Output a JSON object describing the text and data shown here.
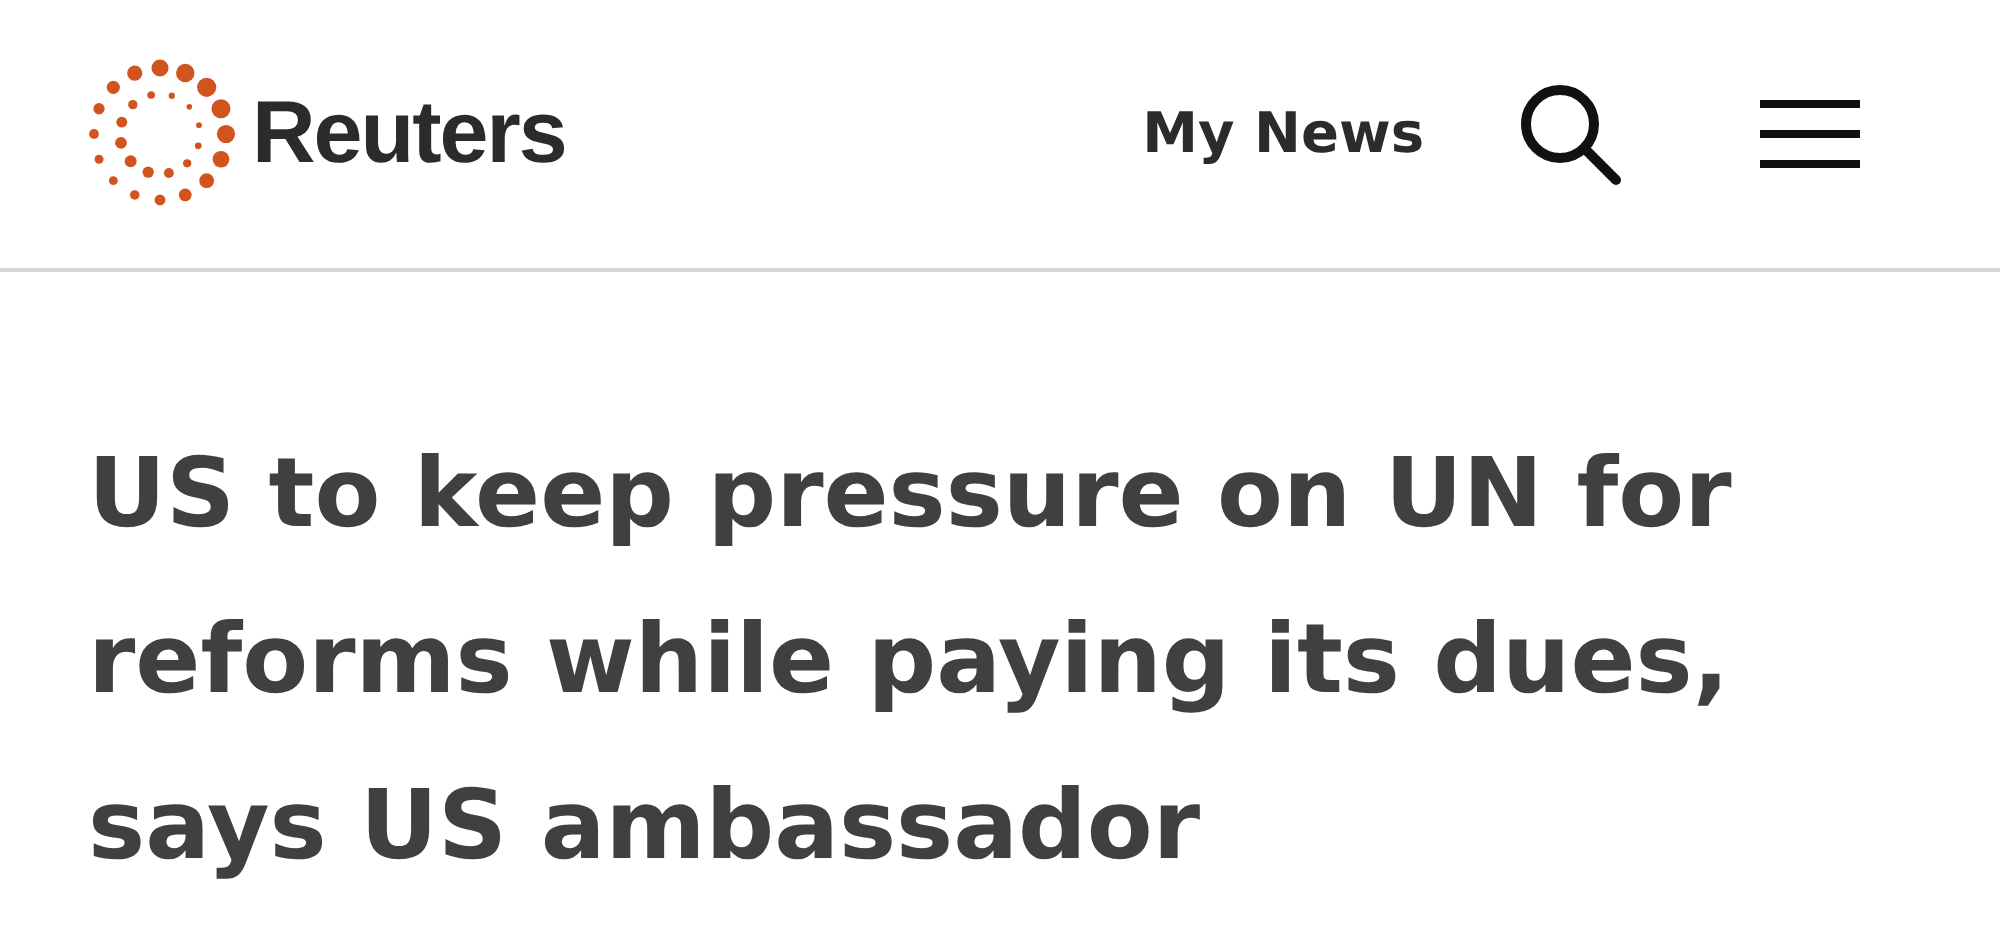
{
  "header": {
    "brand": "Reuters",
    "my_news": "My News"
  },
  "headline": "US to keep pressure on UN for reforms while paying its dues, says US ambassador"
}
